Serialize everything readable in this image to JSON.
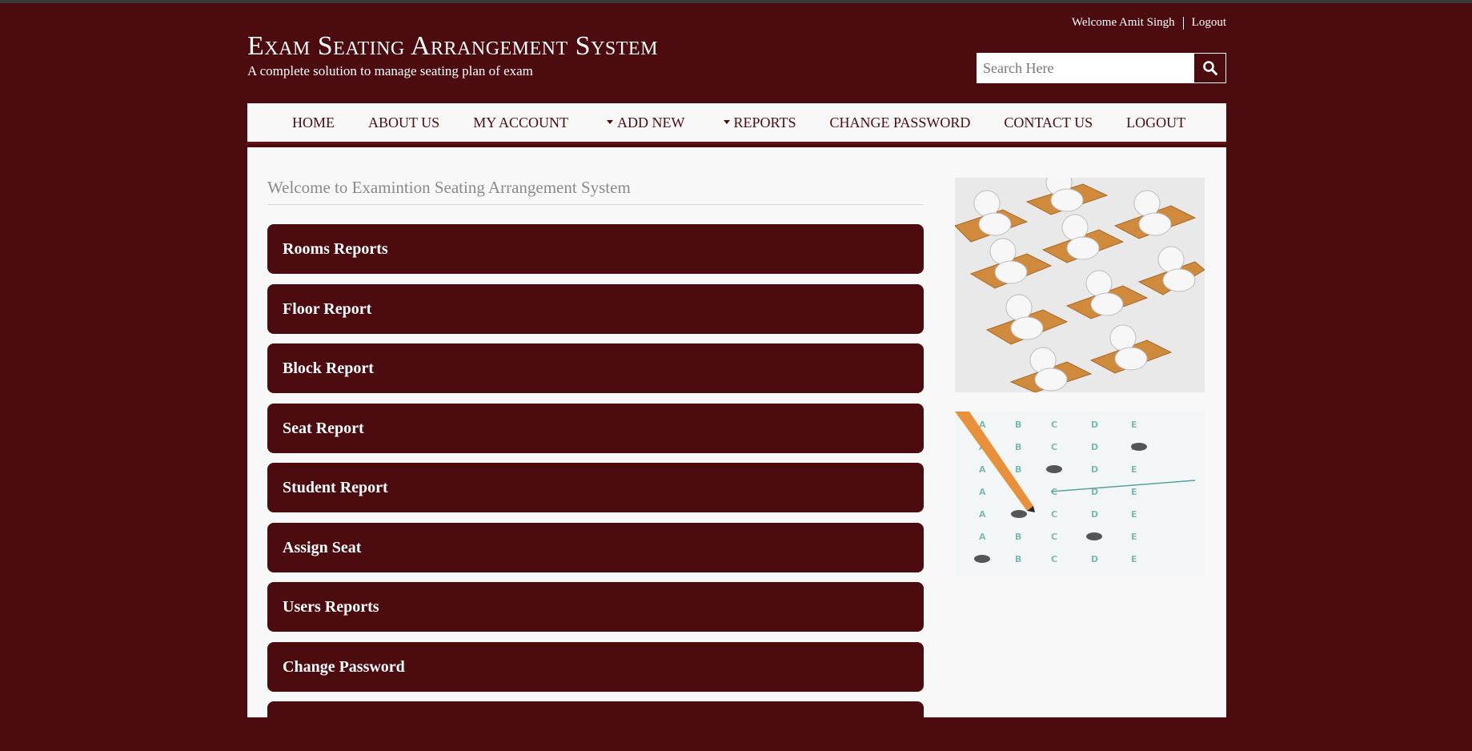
{
  "header": {
    "welcome": "Welcome Amit Singh",
    "logout": "Logout",
    "title": "Exam Seating Arrangement System",
    "subtitle": "A complete solution to manage seating plan of exam"
  },
  "search": {
    "placeholder": "Search Here",
    "icon": "search-icon"
  },
  "nav": {
    "home": "HOME",
    "about": "ABOUT US",
    "account": "MY ACCOUNT",
    "add_new": "ADD NEW",
    "reports": "REPORTS",
    "change_password": "CHANGE PASSWORD",
    "contact": "CONTACT US",
    "logout": "LOGOUT"
  },
  "main": {
    "heading": "Welcome to Examintion Seating Arrangement System",
    "buttons": [
      "Rooms Reports",
      "Floor Report",
      "Block Report",
      "Seat Report",
      "Student Report",
      "Assign Seat",
      "Users Reports",
      "Change Password",
      ""
    ]
  },
  "colors": {
    "brand": "#4b0b0f",
    "panel": "#f8f8f8"
  }
}
